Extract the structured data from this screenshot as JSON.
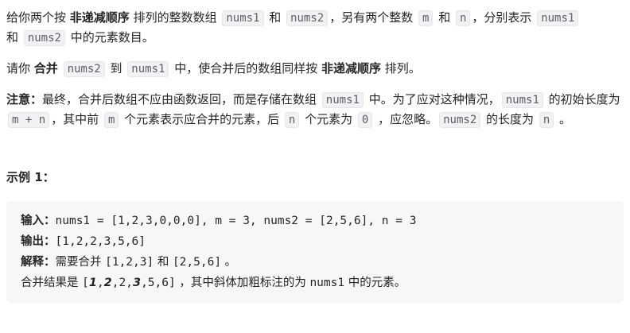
{
  "problem": {
    "p1": {
      "t1": "给你两个按 ",
      "b1": "非递减顺序",
      "t2": " 排列的整数数组 ",
      "c1": "nums1",
      "t3": " 和 ",
      "c2": "nums2",
      "t4": "，另有两个整数 ",
      "c3": "m",
      "t5": " 和 ",
      "c4": "n",
      "t6": "，分别表示 ",
      "c5": "nums1",
      "t7": " 和 ",
      "c6": "nums2",
      "t8": " 中的元素数目。"
    },
    "p2": {
      "t1": "请你 ",
      "b1": "合并",
      "t2": " ",
      "c1": "nums2",
      "t3": " 到 ",
      "c2": "nums1",
      "t4": " 中，使合并后的数组同样按 ",
      "b2": "非递减顺序",
      "t5": " 排列。"
    },
    "p3": {
      "b1": "注意：",
      "t1": "最终，合并后数组不应由函数返回，而是存储在数组 ",
      "c1": "nums1",
      "t2": " 中。为了应对这种情况，",
      "c2": "nums1",
      "t3": " 的初始长度为 ",
      "c3": "m + n",
      "t4": "，其中前 ",
      "c4": "m",
      "t5": " 个元素表示应合并的元素，后 ",
      "c5": "n",
      "t6": " 个元素为 ",
      "c6": "0",
      "t7": " ，应忽略。",
      "c7": "nums2",
      "t8": " 的长度为 ",
      "c8": "n",
      "t9": " 。"
    }
  },
  "example": {
    "title": "示例 1：",
    "input_label": "输入：",
    "input_value": "nums1 = [1,2,3,0,0,0], m = 3, nums2 = [2,5,6], n = 3",
    "output_label": "输出：",
    "output_value": "[1,2,2,3,5,6]",
    "explain_label": "解释：",
    "explain_t1": "需要合并 ",
    "explain_a": "[1,2,3]",
    "explain_t2": " 和 ",
    "explain_b": "[2,5,6]",
    "explain_t3": " 。",
    "result_t1": "合并结果是 ",
    "result_open": "[",
    "result_e1": "1",
    "result_s1": ",",
    "result_e2": "2",
    "result_s2": ",2,",
    "result_e3": "3",
    "result_close": ",5,6]",
    "result_t2": " ，其中斜体加粗标注的为 ",
    "result_c": "nums1",
    "result_t3": " 中的元素。"
  }
}
